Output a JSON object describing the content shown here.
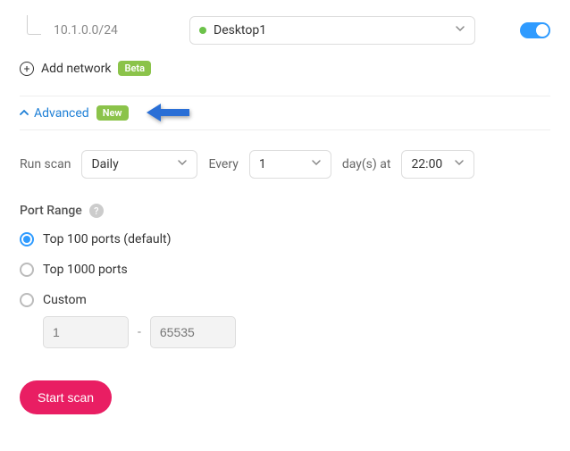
{
  "network": {
    "ip": "10.1.0.0/24",
    "desktop_label": "Desktop1"
  },
  "add_network": {
    "label": "Add network",
    "badge": "Beta"
  },
  "advanced": {
    "label": "Advanced",
    "badge": "New"
  },
  "run_scan": {
    "label": "Run scan",
    "frequency": "Daily",
    "every_label": "Every",
    "every_value": "1",
    "days_at_label": "day(s) at",
    "time": "22:00"
  },
  "port_range": {
    "label": "Port Range",
    "options": {
      "top100": "Top 100 ports (default)",
      "top1000": "Top 1000 ports",
      "custom": "Custom"
    },
    "custom_from_placeholder": "1",
    "custom_to_placeholder": "65535"
  },
  "start_scan_label": "Start scan"
}
